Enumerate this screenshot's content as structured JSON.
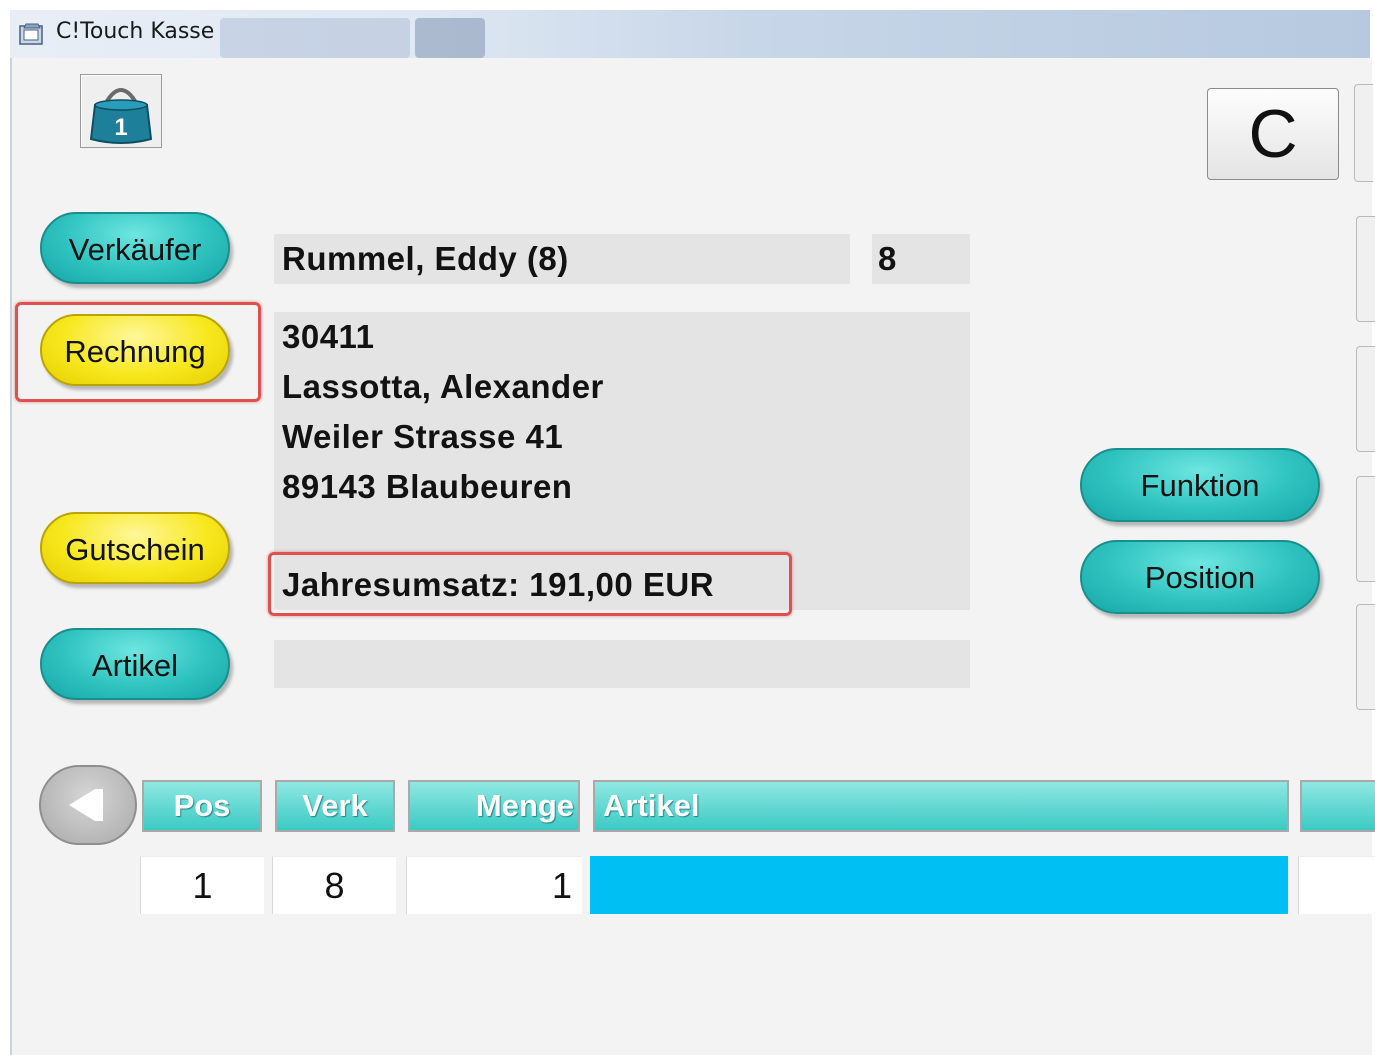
{
  "window": {
    "title": "C!Touch Kasse"
  },
  "toolbar": {
    "bag_count": "1",
    "clear_label": "C"
  },
  "left_buttons": {
    "seller": "Verkäufer",
    "invoice": "Rechnung",
    "voucher": "Gutschein",
    "article": "Artikel"
  },
  "right_buttons": {
    "function": "Funktion",
    "position": "Position"
  },
  "seller_info": {
    "name": "Rummel, Eddy (8)",
    "number": "8"
  },
  "customer": {
    "id": "30411",
    "name": "Lassotta, Alexander",
    "street": "Weiler Strasse 41",
    "city": "89143 Blaubeuren",
    "annual_sales": "Jahresumsatz: 191,00 EUR"
  },
  "table": {
    "headers": {
      "pos": "Pos",
      "verk": "Verk",
      "menge": "Menge",
      "artikel": "Artikel"
    },
    "rows": [
      {
        "pos": "1",
        "verk": "8",
        "menge": "1",
        "artikel": ""
      }
    ]
  },
  "colors": {
    "teal": "#2fc3c0",
    "yellow": "#f7e81e",
    "selection": "#00bff3",
    "highlight": "#e05050"
  }
}
